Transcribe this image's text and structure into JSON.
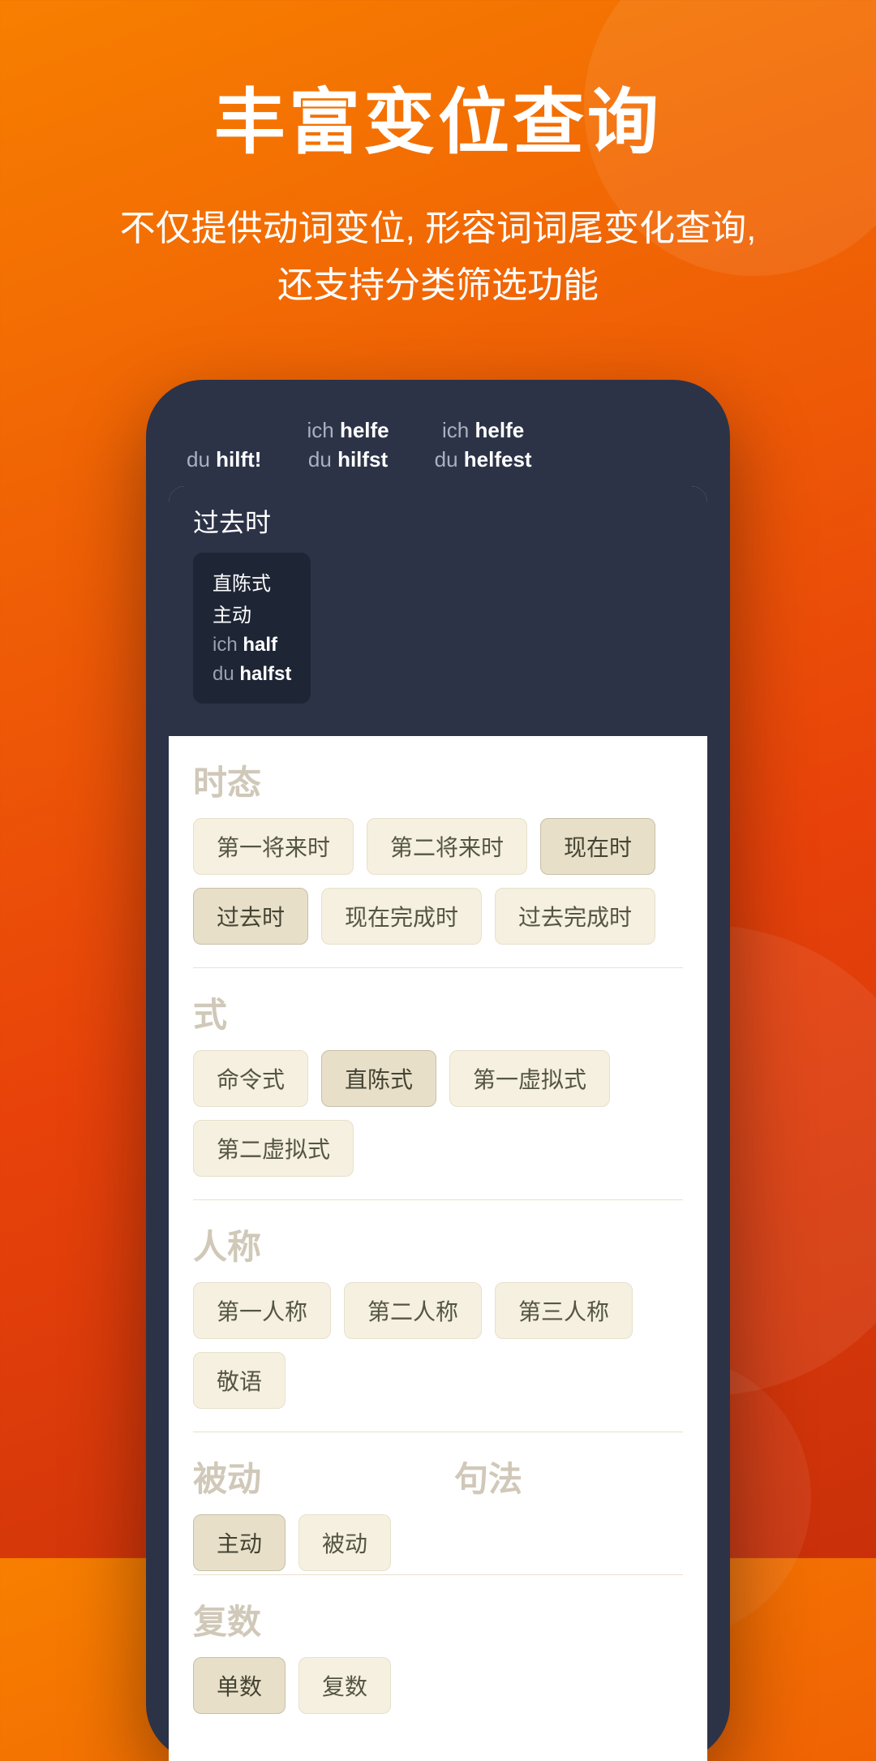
{
  "header": {
    "title": "丰富变位查询",
    "subtitle": "不仅提供动词变位, 形容词词尾变化查询,\n还支持分类筛选功能"
  },
  "phone": {
    "tooltips": [
      {
        "pronoun": "du",
        "verb": "hilft!"
      },
      {
        "pronoun": "ich",
        "verb": "helfe",
        "line2_pronoun": "du",
        "line2_verb": "hilfst"
      },
      {
        "pronoun": "ich",
        "verb": "helfe",
        "line2_pronoun": "du",
        "line2_verb": "helfest"
      }
    ],
    "past_tense_label": "过去时",
    "indicator": {
      "mode": "直陈式",
      "voice": "主动",
      "line1_pronoun": "ich",
      "line1_verb": "half",
      "line2_pronoun": "du",
      "line2_verb": "halfst"
    },
    "filters": {
      "tense_title": "时态",
      "tense_chips": [
        "第一将来时",
        "第二将来时",
        "现在时",
        "过去时",
        "现在完成时",
        "过去完成时"
      ],
      "mode_title": "式",
      "mode_chips": [
        "命令式",
        "直陈式",
        "第一虚拟式",
        "第二虚拟式"
      ],
      "person_title": "人称",
      "person_chips": [
        "第一人称",
        "第二人称",
        "第三人称",
        "敬语"
      ],
      "voice_title": "被动",
      "voice_chips": [
        "主动",
        "被动"
      ],
      "syntax_title": "句法",
      "plural_title": "复数",
      "plural_chips": [
        "单数",
        "复数"
      ]
    }
  }
}
